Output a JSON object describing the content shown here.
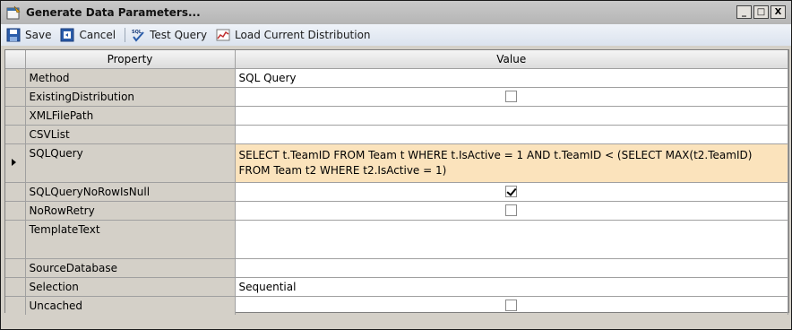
{
  "window": {
    "title": "Generate Data Parameters...",
    "buttons": {
      "minimize": "_",
      "maximize": "□",
      "close": "X"
    }
  },
  "toolbar": {
    "save_label": "Save",
    "cancel_label": "Cancel",
    "test_query_label": "Test Query",
    "load_distribution_label": "Load Current Distribution"
  },
  "grid": {
    "headers": {
      "property": "Property",
      "value": "Value"
    },
    "rows": [
      {
        "property": "Method",
        "value": "SQL Query",
        "type": "text"
      },
      {
        "property": "ExistingDistribution",
        "value": "",
        "type": "checkbox",
        "checked": false
      },
      {
        "property": "XMLFilePath",
        "value": "",
        "type": "text"
      },
      {
        "property": "CSVList",
        "value": "",
        "type": "text"
      },
      {
        "property": "SQLQuery",
        "value": "SELECT t.TeamID FROM Team t WHERE t.IsActive = 1 AND  t.TeamID < (SELECT MAX(t2.TeamID) FROM Team t2 WHERE t2.IsActive = 1)",
        "type": "text",
        "active": true
      },
      {
        "property": "SQLQueryNoRowIsNull",
        "value": "",
        "type": "checkbox",
        "checked": true
      },
      {
        "property": "NoRowRetry",
        "value": "",
        "type": "checkbox",
        "checked": false
      },
      {
        "property": "TemplateText",
        "value": "",
        "type": "text"
      },
      {
        "property": "SourceDatabase",
        "value": "",
        "type": "text"
      },
      {
        "property": "Selection",
        "value": "Sequential",
        "type": "text"
      },
      {
        "property": "Uncached",
        "value": "",
        "type": "checkbox",
        "checked": false
      }
    ]
  },
  "colors": {
    "active_row": "#fbe3bc",
    "property_column": "#d4d0c8"
  }
}
